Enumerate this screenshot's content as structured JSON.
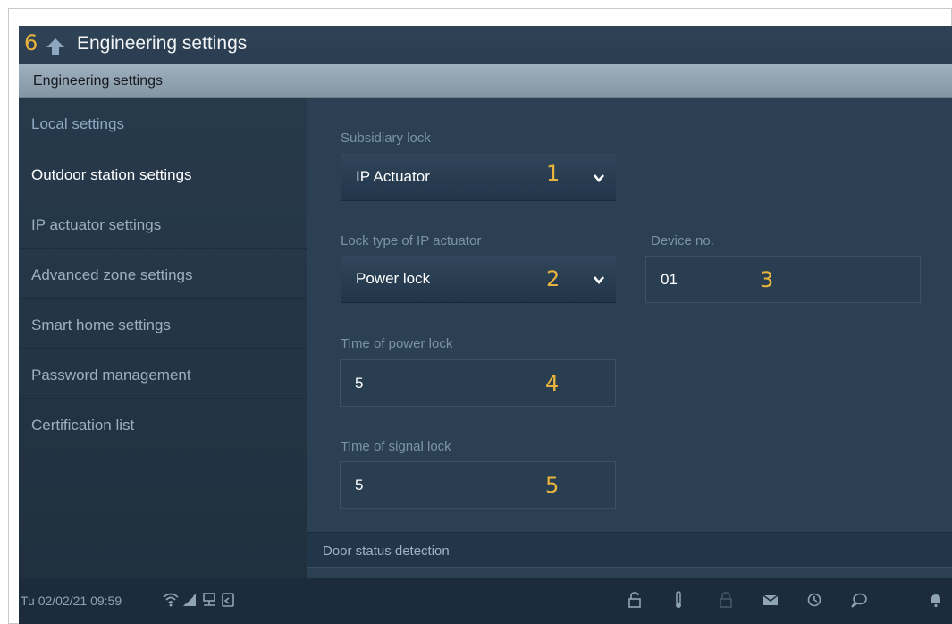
{
  "title_bar": {
    "callout_number": "6",
    "title": "Engineering settings"
  },
  "section_header": "Engineering settings",
  "sidebar": {
    "items": [
      {
        "label": "Local settings"
      },
      {
        "label": "Outdoor station settings",
        "active": true
      },
      {
        "label": "IP actuator settings"
      },
      {
        "label": "Advanced zone settings"
      },
      {
        "label": "Smart home settings"
      },
      {
        "label": "Password management"
      },
      {
        "label": "Certification list"
      }
    ]
  },
  "main": {
    "subsidiary_lock": {
      "label": "Subsidiary lock",
      "value": "IP Actuator",
      "callout": "1"
    },
    "lock_type": {
      "label": "Lock type of IP actuator",
      "value": "Power lock",
      "callout": "2"
    },
    "device_no": {
      "label": "Device no.",
      "value": "01",
      "callout": "3"
    },
    "time_power_lock": {
      "label": "Time of power lock",
      "value": "5",
      "callout": "4"
    },
    "time_signal_lock": {
      "label": "Time of signal lock",
      "value": "5",
      "callout": "5"
    },
    "door_status": {
      "label": "Door status detection"
    }
  },
  "status_bar": {
    "datetime": "Tu 02/02/21  09:59",
    "left_icons": [
      "wifi-icon",
      "signal-icon",
      "network-icon",
      "return-home-icon"
    ],
    "right_icons": [
      "unlock-icon",
      "thermometer-icon",
      "lock-icon",
      "mail-icon",
      "history-icon",
      "chat-icon",
      "bell-icon"
    ]
  },
  "colors": {
    "accent_callout": "#e9b43c",
    "background": "#2b3f52",
    "section_bar": "#8d9eae"
  }
}
